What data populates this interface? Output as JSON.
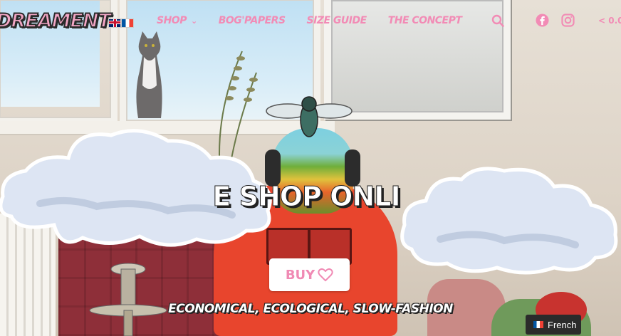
{
  "header": {
    "logo_text": "DREAMENT",
    "languages": [
      {
        "code": "en",
        "icon": "uk-flag-icon"
      },
      {
        "code": "fr",
        "icon": "france-flag-icon"
      }
    ],
    "nav": [
      {
        "label": "SHOP",
        "has_dropdown": true
      },
      {
        "label": "BOG'PAPERS",
        "has_dropdown": false
      },
      {
        "label": "SIZE GUIDE",
        "has_dropdown": false
      },
      {
        "label": "THE CONCEPT",
        "has_dropdown": false
      }
    ],
    "icons": [
      "search-icon",
      "facebook-icon",
      "instagram-icon"
    ],
    "cart_label": "< 0.0"
  },
  "hero": {
    "title": "E SHOP ONLI",
    "buy_label": "BUY",
    "buy_icon": "heart-icon",
    "tagline": "ECONOMICAL, ECOLOGICAL, SLOW-FASHION"
  },
  "language_switcher": {
    "label": "French",
    "icon": "france-flag-icon"
  },
  "colors": {
    "brand_pink": "#f28bb5",
    "hoodie_red": "#e8452d",
    "cloud_blue": "#dbe3f2"
  }
}
